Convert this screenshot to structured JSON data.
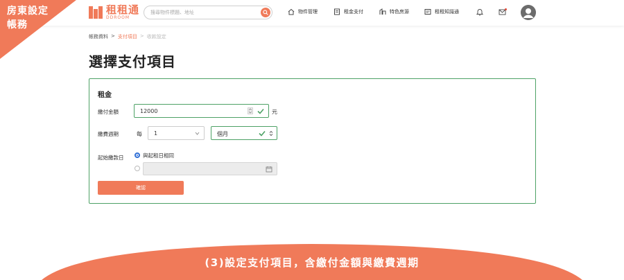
{
  "corner_label": {
    "line1": "房東設定",
    "line2": "帳務"
  },
  "logo": {
    "name": "租租通",
    "sub": "DDROOM"
  },
  "search": {
    "placeholder": "搜尋物件標題、地址"
  },
  "nav": [
    {
      "label": "物件管理",
      "icon": "house-icon"
    },
    {
      "label": "租金支付",
      "icon": "bill-icon"
    },
    {
      "label": "特色房源",
      "icon": "feature-house-icon"
    },
    {
      "label": "租租知識通",
      "icon": "book-icon"
    }
  ],
  "breadcrumb": {
    "item1": "帳務資料",
    "item2": "支付項目",
    "item3": "收款設定",
    "sep": ">"
  },
  "page": {
    "title": "選擇支付項目"
  },
  "form": {
    "section_title": "租金",
    "amount": {
      "label": "繳付金額",
      "value": "12000",
      "unit": "元"
    },
    "period": {
      "label": "繳費週期",
      "prefix": "每",
      "count": "1",
      "unit": "個月"
    },
    "start": {
      "label": "起始繳款日",
      "option1": "與起租日相同"
    },
    "confirm": "確認"
  },
  "banner": {
    "text": "(3)設定支付項目，含繳付金額與繳費週期"
  },
  "colors": {
    "accent": "#f07a59",
    "valid": "#4da165",
    "radio": "#2f6fd6"
  }
}
